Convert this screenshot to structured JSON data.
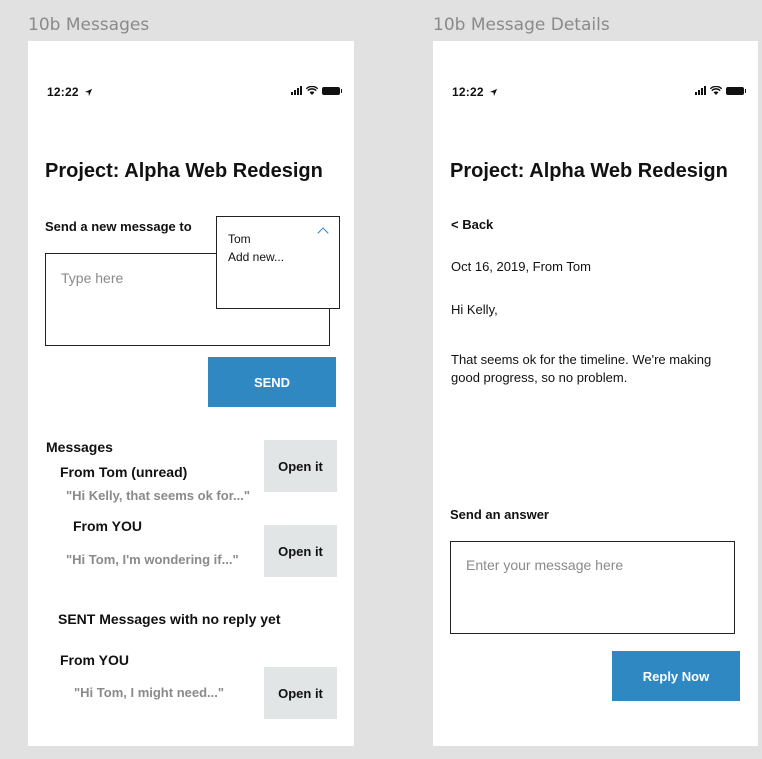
{
  "artboards": {
    "messages_title": "10b Messages",
    "details_title": "10b Message Details"
  },
  "status_bar": {
    "time": "12:22",
    "location_icon": "location-arrow-icon",
    "icons": [
      "signal-icon",
      "wifi-icon",
      "battery-icon"
    ]
  },
  "project_title": "Project: Alpha Web Redesign",
  "messages_screen": {
    "send_to_label": "Send a new message to",
    "recipient_dropdown": {
      "options": [
        "Tom",
        "Add new..."
      ],
      "toggle_icon": "chevron-up-icon"
    },
    "message_placeholder": "Type here",
    "send_label": "SEND",
    "messages_heading": "Messages",
    "messages": [
      {
        "from": "From Tom (unread)",
        "preview": "\"Hi Kelly, that seems ok for...\"",
        "action": "Open it"
      },
      {
        "from": "From YOU",
        "preview": "\"Hi Tom, I'm wondering if...\"",
        "action": "Open it"
      }
    ],
    "sent_heading": "SENT Messages with no reply yet",
    "sent": [
      {
        "from": "From YOU",
        "preview": "\"Hi Tom, I might need...\"",
        "action": "Open it"
      }
    ]
  },
  "details_screen": {
    "back_label": "< Back",
    "meta": "Oct 16, 2019, From Tom",
    "greeting": "Hi Kelly,",
    "body": "That seems ok for the timeline. We're making good progress, so no problem.",
    "answer_label": "Send an answer",
    "answer_placeholder": "Enter your message here",
    "reply_label": "Reply Now"
  },
  "colors": {
    "background": "#e1e1e1",
    "accent": "#2f88c2",
    "secondary_button": "#e2e5e6",
    "muted_text": "#8a8a8a"
  }
}
